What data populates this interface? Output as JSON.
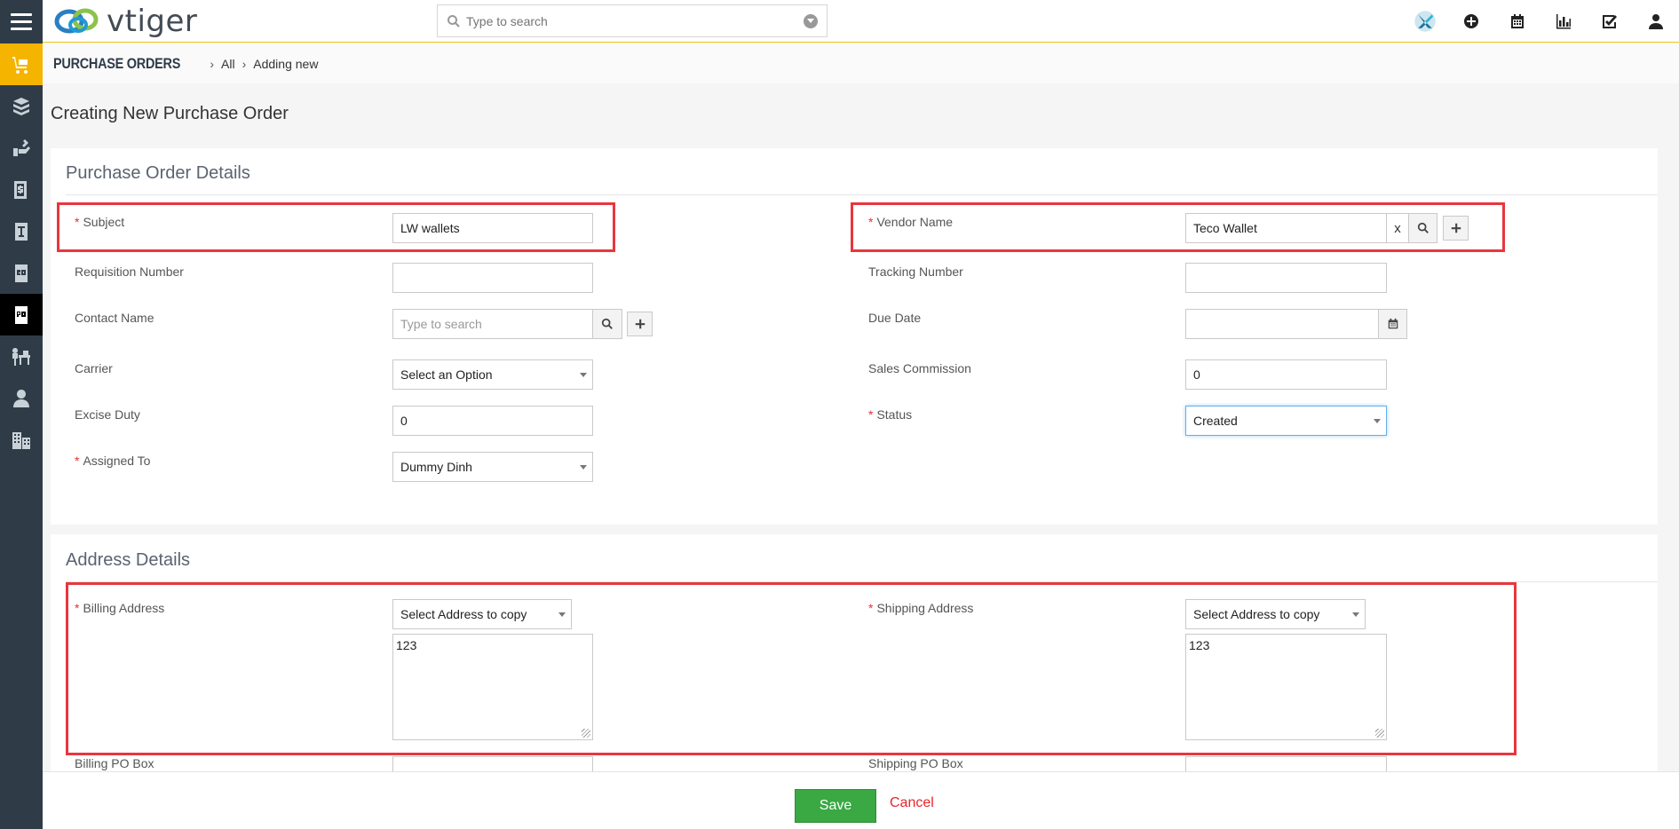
{
  "app": {
    "logo_text": "vtiger"
  },
  "search": {
    "placeholder": "Type to search"
  },
  "breadcrumb": {
    "module": "PURCHASE ORDERS",
    "all": "All",
    "current": "Adding new"
  },
  "page_title": "Creating New Purchase Order",
  "sections": {
    "details": {
      "title": "Purchase Order Details",
      "subject": {
        "label": "Subject",
        "value": "LW wallets"
      },
      "vendor_name": {
        "label": "Vendor Name",
        "value": "Teco Wallet",
        "clear": "x"
      },
      "requisition_number": {
        "label": "Requisition Number",
        "value": ""
      },
      "tracking_number": {
        "label": "Tracking Number",
        "value": ""
      },
      "contact_name": {
        "label": "Contact Name",
        "placeholder": "Type to search"
      },
      "due_date": {
        "label": "Due Date",
        "value": ""
      },
      "carrier": {
        "label": "Carrier",
        "value": "Select an Option"
      },
      "sales_commission": {
        "label": "Sales Commission",
        "value": "0"
      },
      "excise_duty": {
        "label": "Excise Duty",
        "value": "0"
      },
      "status": {
        "label": "Status",
        "value": "Created"
      },
      "assigned_to": {
        "label": "Assigned To",
        "value": "Dummy Dinh"
      }
    },
    "address": {
      "title": "Address Details",
      "billing_address": {
        "label": "Billing Address",
        "copy_select": "Select Address to copy",
        "value": "123"
      },
      "shipping_address": {
        "label": "Shipping Address",
        "copy_select": "Select Address to copy",
        "value": "123"
      },
      "billing_po_box": {
        "label": "Billing PO Box"
      },
      "shipping_po_box": {
        "label": "Shipping PO Box"
      }
    }
  },
  "required_mark": "*",
  "footer": {
    "save_label": "Save",
    "cancel_label": "Cancel"
  },
  "colors": {
    "sidebar": "#2f3c48",
    "accent": "#f5b400",
    "save": "#3aa843",
    "cancel": "#e8252b",
    "highlight": "#e8363d"
  }
}
